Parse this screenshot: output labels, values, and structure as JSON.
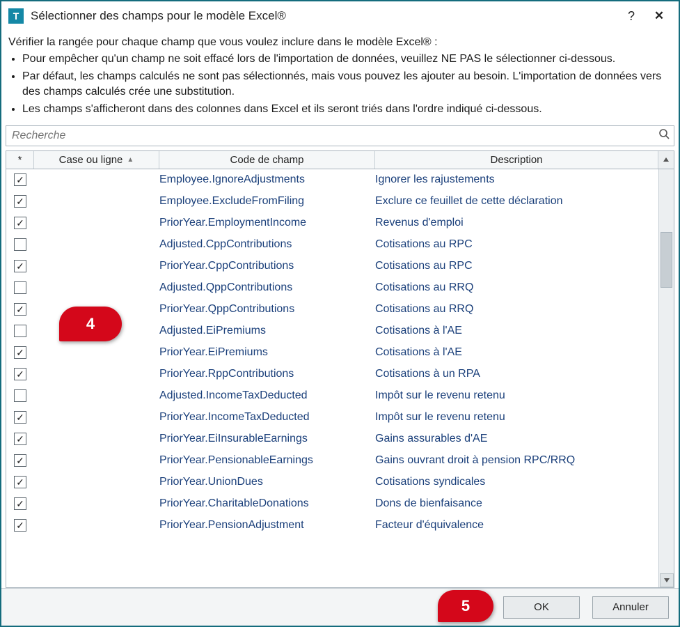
{
  "titlebar": {
    "title": "Sélectionner des champs pour le modèle Excel®",
    "help_char": "?",
    "close_char": "✕"
  },
  "instructions": {
    "lead": "Vérifier la rangée pour chaque champ que vous voulez inclure dans le modèle Excel® :",
    "bullets": [
      "Pour empêcher qu'un champ ne soit effacé lors de l'importation de données, veuillez NE PAS le sélectionner ci-dessous.",
      "Par défaut, les champs calculés ne sont pas sélectionnés, mais vous pouvez les ajouter au besoin. L'importation de données vers des champs calculés crée une substitution.",
      "Les champs s'afficheront dans des colonnes dans Excel et ils seront triés dans l'ordre indiqué ci-dessous."
    ]
  },
  "search": {
    "placeholder": "Recherche"
  },
  "grid": {
    "headers": {
      "star": "*",
      "box": "Case ou ligne",
      "code": "Code de champ",
      "desc": "Description"
    },
    "rows": [
      {
        "checked": true,
        "code": "Employee.IgnoreAdjustments",
        "desc": "Ignorer les rajustements"
      },
      {
        "checked": true,
        "code": "Employee.ExcludeFromFiling",
        "desc": "Exclure ce feuillet de cette déclaration"
      },
      {
        "checked": true,
        "code": "PriorYear.EmploymentIncome",
        "desc": "Revenus d'emploi"
      },
      {
        "checked": false,
        "code": "Adjusted.CppContributions",
        "desc": "Cotisations au RPC"
      },
      {
        "checked": true,
        "code": "PriorYear.CppContributions",
        "desc": "Cotisations au RPC"
      },
      {
        "checked": false,
        "code": "Adjusted.QppContributions",
        "desc": "Cotisations au RRQ"
      },
      {
        "checked": true,
        "code": "PriorYear.QppContributions",
        "desc": "Cotisations au RRQ"
      },
      {
        "checked": false,
        "code": "Adjusted.EiPremiums",
        "desc": "Cotisations à l'AE"
      },
      {
        "checked": true,
        "code": "PriorYear.EiPremiums",
        "desc": "Cotisations à l'AE"
      },
      {
        "checked": true,
        "code": "PriorYear.RppContributions",
        "desc": "Cotisations à un RPA"
      },
      {
        "checked": false,
        "code": "Adjusted.IncomeTaxDeducted",
        "desc": "Impôt sur le revenu retenu"
      },
      {
        "checked": true,
        "code": "PriorYear.IncomeTaxDeducted",
        "desc": "Impôt sur le revenu retenu"
      },
      {
        "checked": true,
        "code": "PriorYear.EiInsurableEarnings",
        "desc": "Gains assurables d'AE"
      },
      {
        "checked": true,
        "code": "PriorYear.PensionableEarnings",
        "desc": "Gains ouvrant droit à pension RPC/RRQ"
      },
      {
        "checked": true,
        "code": "PriorYear.UnionDues",
        "desc": "Cotisations syndicales"
      },
      {
        "checked": true,
        "code": "PriorYear.CharitableDonations",
        "desc": "Dons de bienfaisance"
      },
      {
        "checked": true,
        "code": "PriorYear.PensionAdjustment",
        "desc": "Facteur d'équivalence"
      }
    ]
  },
  "buttons": {
    "ok": "OK",
    "cancel": "Annuler"
  },
  "callouts": {
    "c4": "4",
    "c5": "5"
  }
}
